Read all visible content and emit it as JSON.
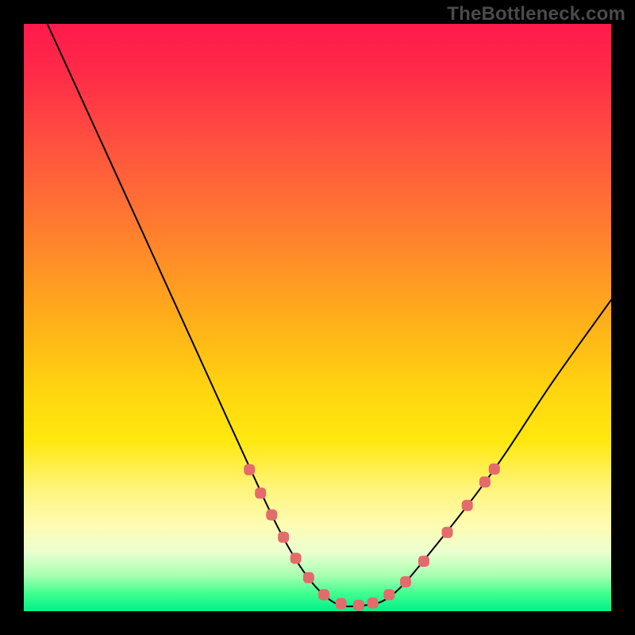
{
  "watermark": {
    "text": "TheBottleneck.com"
  },
  "colors": {
    "background": "#000000",
    "curve_stroke": "#000000",
    "dot_fill": "#e46b6b",
    "watermark_text": "#4a4a4a",
    "gradient_top": "#ff1a4d",
    "gradient_bottom": "#00f08a"
  },
  "chart_data": {
    "type": "line",
    "title": "",
    "xlabel": "",
    "ylabel": "",
    "xlim": [
      0,
      100
    ],
    "ylim": [
      0,
      100
    ],
    "grid": false,
    "notes": "Background is a vertical red→yellow→green gradient. A black V-shaped curve descends steeply from top-left, flattens near the bottom around x≈50–60, then rises toward the right. Salmon rounded markers highlight the segment of the curve roughly from y≈24 down through the minimum and back up to y≈24.",
    "series": [
      {
        "name": "curve",
        "style": "line",
        "xy": [
          [
            4,
            100
          ],
          [
            20,
            65
          ],
          [
            35,
            32
          ],
          [
            45,
            11
          ],
          [
            52,
            2
          ],
          [
            58,
            1
          ],
          [
            63,
            3
          ],
          [
            70,
            11
          ],
          [
            80,
            24
          ],
          [
            90,
            39
          ],
          [
            100,
            53
          ]
        ]
      },
      {
        "name": "highlight-dots",
        "style": "markers",
        "xy": [
          [
            38.4,
            24.1
          ],
          [
            40.3,
            20.1
          ],
          [
            42.2,
            16.4
          ],
          [
            44.2,
            12.6
          ],
          [
            46.3,
            9.0
          ],
          [
            48.5,
            5.7
          ],
          [
            51.1,
            2.8
          ],
          [
            54.0,
            1.3
          ],
          [
            57.0,
            1.0
          ],
          [
            59.4,
            1.4
          ],
          [
            62.2,
            2.8
          ],
          [
            65.0,
            5.0
          ],
          [
            68.1,
            8.5
          ],
          [
            72.1,
            13.4
          ],
          [
            75.5,
            18.0
          ],
          [
            78.5,
            22.0
          ],
          [
            80.1,
            24.2
          ]
        ]
      }
    ]
  }
}
